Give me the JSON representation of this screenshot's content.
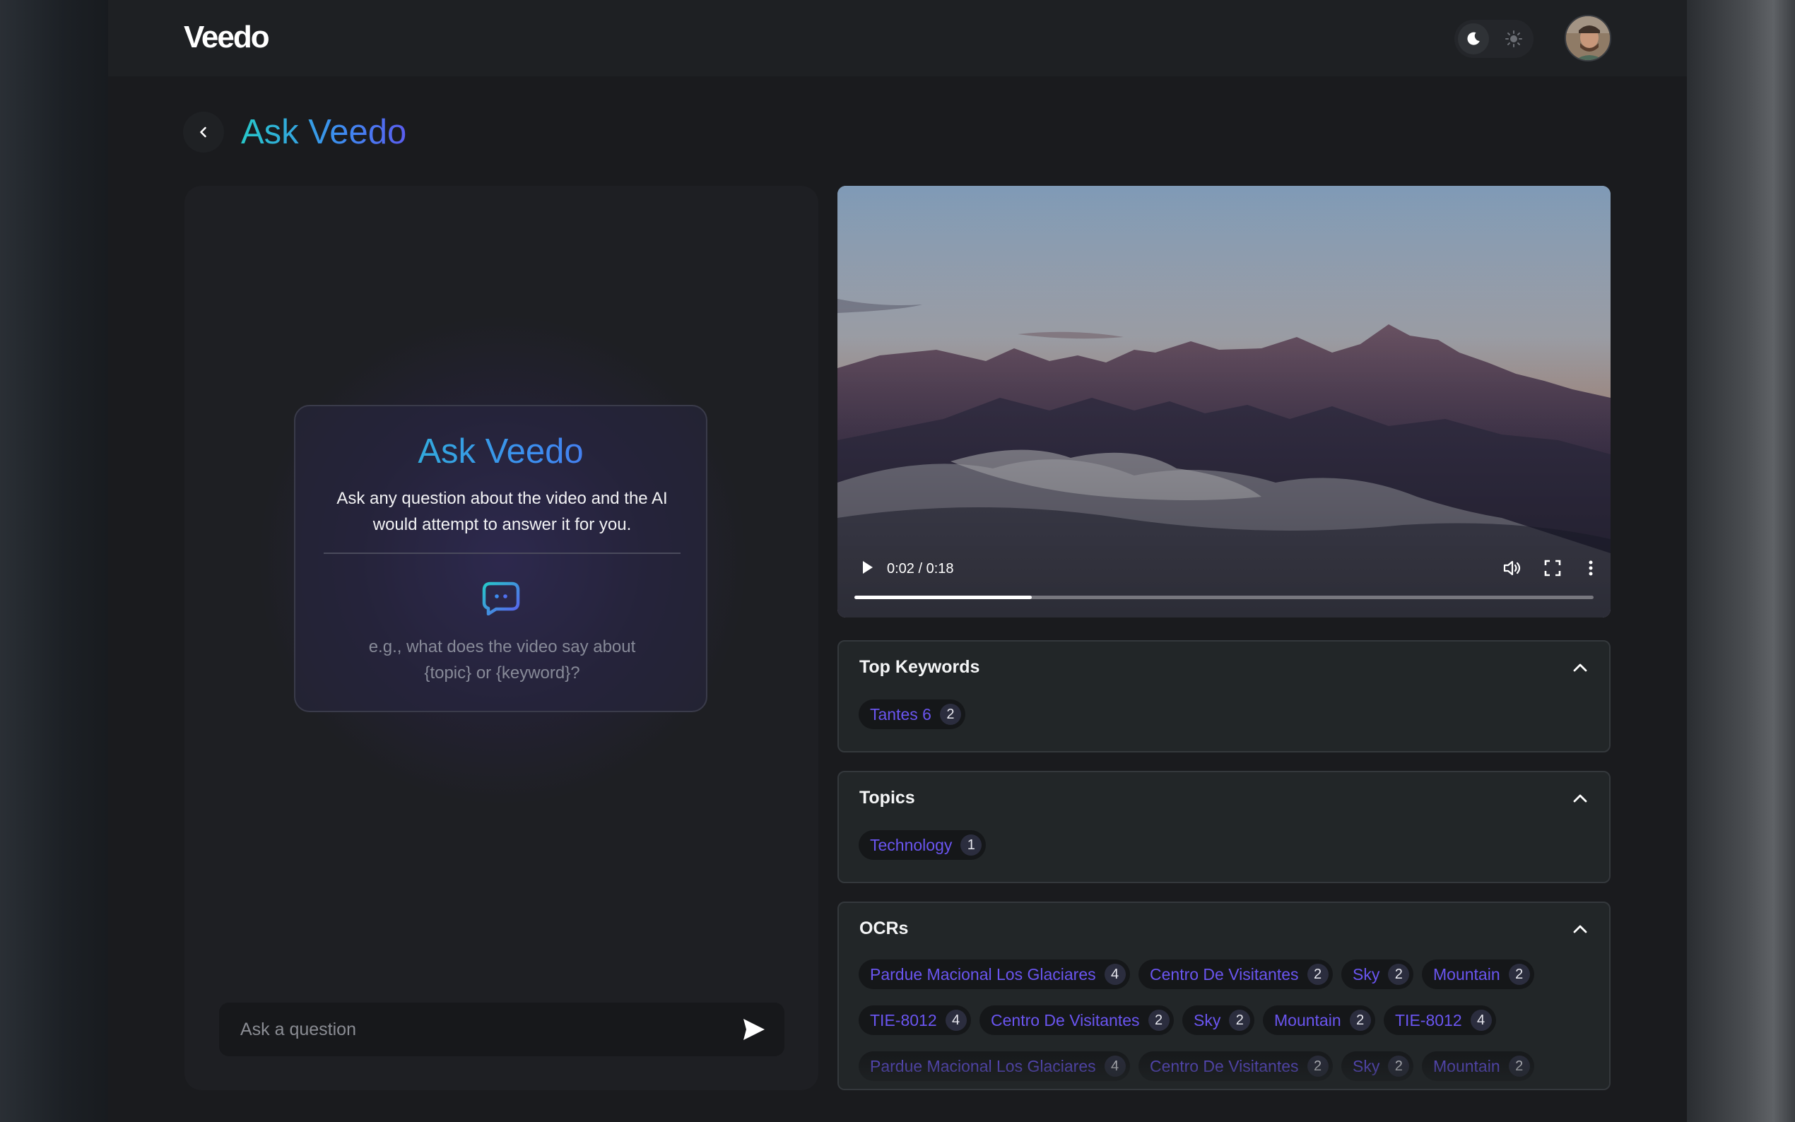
{
  "app": {
    "logo": "Veedo"
  },
  "header": {
    "theme_modes": [
      "dark",
      "light"
    ],
    "active_theme": "dark"
  },
  "page": {
    "title": "Ask Veedo"
  },
  "chat": {
    "intro_title": "Ask Veedo",
    "intro_text": "Ask any question about the video and the AI would attempt to answer it for you.",
    "hint_line1": "e.g., what does the video say about",
    "hint_line2": "{topic} or {keyword}?",
    "input_placeholder": "Ask a question",
    "input_value": ""
  },
  "video": {
    "time_display": "0:02 / 0:18",
    "progress": 0.24
  },
  "top_keywords": {
    "title": "Top Keywords",
    "items": [
      {
        "label": "Tantes 6",
        "count": "2"
      }
    ]
  },
  "topics": {
    "title": "Topics",
    "items": [
      {
        "label": "Technology",
        "count": "1"
      }
    ]
  },
  "ocrs": {
    "title": "OCRs",
    "items": [
      {
        "label": "Pardue Macional Los Glaciares",
        "count": "4"
      },
      {
        "label": "Centro De Visitantes",
        "count": "2"
      },
      {
        "label": "Sky",
        "count": "2"
      },
      {
        "label": "Mountain",
        "count": "2"
      },
      {
        "label": "TIE-8012",
        "count": "4"
      },
      {
        "label": "Centro De Visitantes",
        "count": "2"
      },
      {
        "label": "Sky",
        "count": "2"
      },
      {
        "label": "Mountain",
        "count": "2"
      },
      {
        "label": "TIE-8012",
        "count": "4"
      },
      {
        "label": "Pardue Macional Los Glaciares",
        "count": "4"
      },
      {
        "label": "Centro De Visitantes",
        "count": "2"
      },
      {
        "label": "Sky",
        "count": "2"
      },
      {
        "label": "Mountain",
        "count": "2"
      }
    ]
  },
  "colors": {
    "accent": "#6a55f0",
    "title_gradient_start": "#27c7c9",
    "title_gradient_end": "#5a5df0"
  }
}
